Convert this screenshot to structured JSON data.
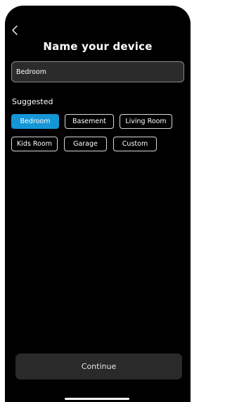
{
  "header": {
    "back_icon": "chevron-left-icon",
    "title": "Name your device"
  },
  "name_input": {
    "value": "Bedroom"
  },
  "suggested": {
    "label": "Suggested",
    "chips": [
      {
        "label": "Bedroom",
        "selected": true
      },
      {
        "label": "Basement",
        "selected": false
      },
      {
        "label": "Living Room",
        "selected": false
      },
      {
        "label": "Kids Room",
        "selected": false
      },
      {
        "label": "Garage",
        "selected": false
      },
      {
        "label": "Custom",
        "selected": false
      }
    ]
  },
  "footer": {
    "continue_label": "Continue"
  },
  "colors": {
    "background": "#000000",
    "accent": "#1596d6",
    "input_bg": "#2b2b2b",
    "button_bg": "#2a2a2a"
  }
}
